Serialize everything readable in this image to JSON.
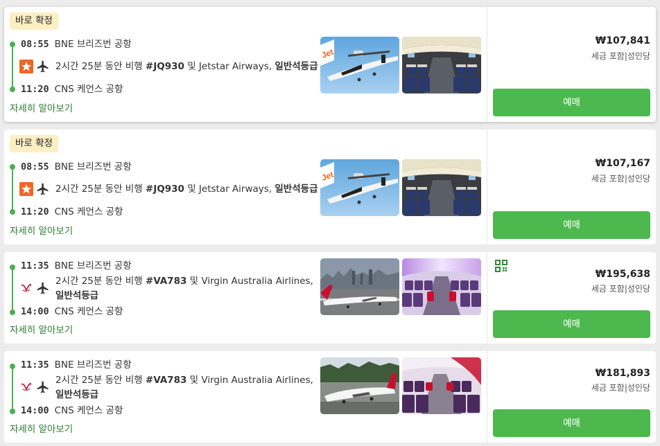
{
  "cards": [
    {
      "badge": "바로 확정",
      "depart_time": "08:55",
      "depart_airport": "BNE 브리즈번 공항",
      "arrive_time": "11:20",
      "arrive_airport": "CNS 케언스 공항",
      "duration": "2시간 25분 동안 비행",
      "flight_no": "#JQ930",
      "conj": "및",
      "airline": "Jetstar Airways,",
      "cabin": "일반석등급",
      "details_link": "자세히 알아보기",
      "price": "₩107,841",
      "tax_note": "세금 포함|성인당",
      "book_label": "예매",
      "airline_logo": "jetstar-star-icon",
      "photo1": "jetstar-aircraft-photo",
      "photo2": "cabin-interior-photo"
    },
    {
      "badge": "바로 확정",
      "depart_time": "08:55",
      "depart_airport": "BNE 브리즈번 공항",
      "arrive_time": "11:20",
      "arrive_airport": "CNS 케언스 공항",
      "duration": "2시간 25분 동안 비행",
      "flight_no": "#JQ930",
      "conj": "및",
      "airline": "Jetstar Airways,",
      "cabin": "일반석등급",
      "details_link": "자세히 알아보기",
      "price": "₩107,167",
      "tax_note": "세금 포함|성인당",
      "book_label": "예매",
      "airline_logo": "jetstar-star-icon",
      "photo1": "jetstar-aircraft-photo",
      "photo2": "cabin-interior-photo"
    },
    {
      "depart_time": "11:35",
      "depart_airport": "BNE 브리즈번 공항",
      "arrive_time": "14:00",
      "arrive_airport": "CNS 케언스 공항",
      "duration": "2시간 25분 동안 비행",
      "flight_no": "#VA783",
      "conj": "및",
      "airline": "Virgin Australia Airlines,",
      "cabin": "일반석등급",
      "details_link": "자세히 알아보기",
      "price": "₩195,638",
      "tax_note": "세금 포함|성인당",
      "book_label": "예매",
      "airline_logo": "virgin-logo-icon",
      "photo1": "virgin-aircraft-photo",
      "photo2": "cabin-interior-photo",
      "extra_icon": "qr-code-icon"
    },
    {
      "depart_time": "11:35",
      "depart_airport": "BNE 브리즈번 공항",
      "arrive_time": "14:00",
      "arrive_airport": "CNS 케언스 공항",
      "duration": "2시간 25분 동안 비행",
      "flight_no": "#VA783",
      "conj": "및",
      "airline": "Virgin Australia Airlines,",
      "cabin": "일반석등급",
      "details_link": "자세히 알아보기",
      "price": "₩181,893",
      "tax_note": "세금 포함|성인당",
      "book_label": "예매",
      "airline_logo": "virgin-logo-icon",
      "photo1": "virgin-aircraft-photo",
      "photo2": "cabin-interior-photo"
    }
  ],
  "colors": {
    "accent_green": "#4cb84e",
    "link_green": "#2e7d32",
    "badge_bg": "#fdefc4",
    "jetstar_orange": "#f26522",
    "virgin_red": "#c8102e"
  }
}
